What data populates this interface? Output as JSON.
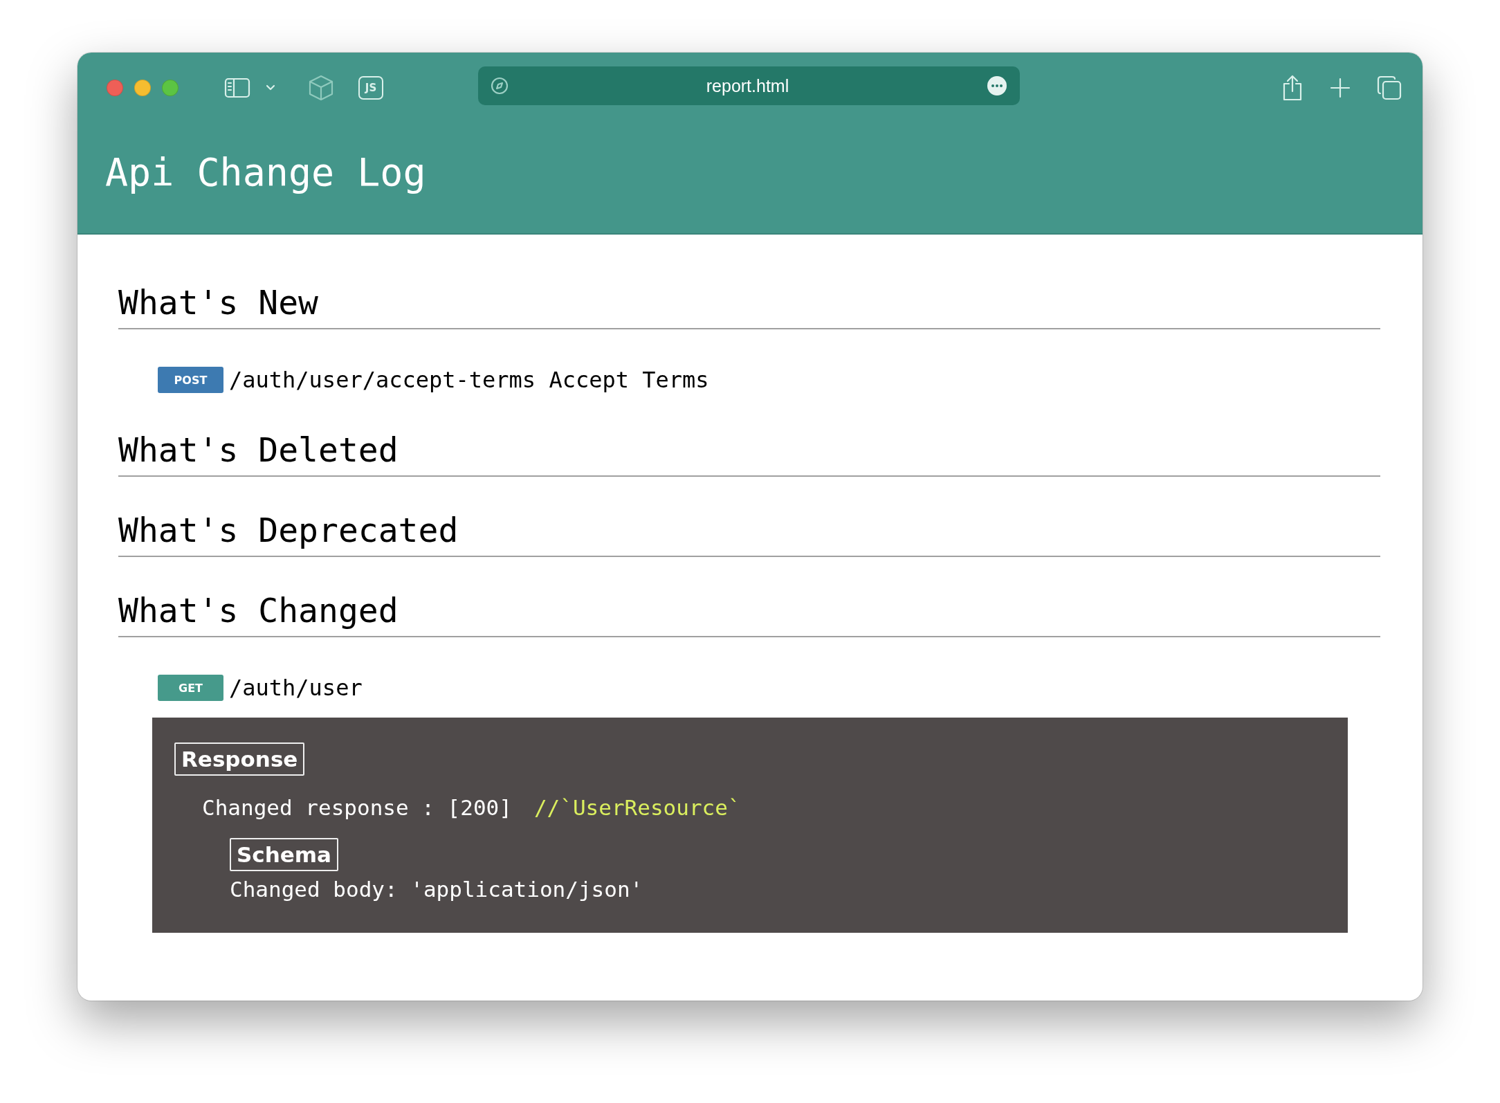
{
  "browser": {
    "extension_label": "JS",
    "url": "report.html"
  },
  "header": {
    "title": "Api Change Log"
  },
  "sections": [
    {
      "heading": "What's New",
      "endpoints": [
        {
          "method": "POST",
          "color": "#3d7ab1",
          "path": "/auth/user/accept-terms",
          "summary": "Accept Terms"
        }
      ]
    },
    {
      "heading": "What's Deleted"
    },
    {
      "heading": "What's Deprecated"
    },
    {
      "heading": "What's Changed",
      "endpoints": [
        {
          "method": "GET",
          "color": "#469a8b",
          "path": "/auth/user",
          "details": {
            "response_label": "Response",
            "response_line": "Changed response : [200]",
            "response_comment": "//`UserResource`",
            "schema_label": "Schema",
            "schema_body": "Changed body: 'application/json'"
          }
        }
      ]
    }
  ]
}
